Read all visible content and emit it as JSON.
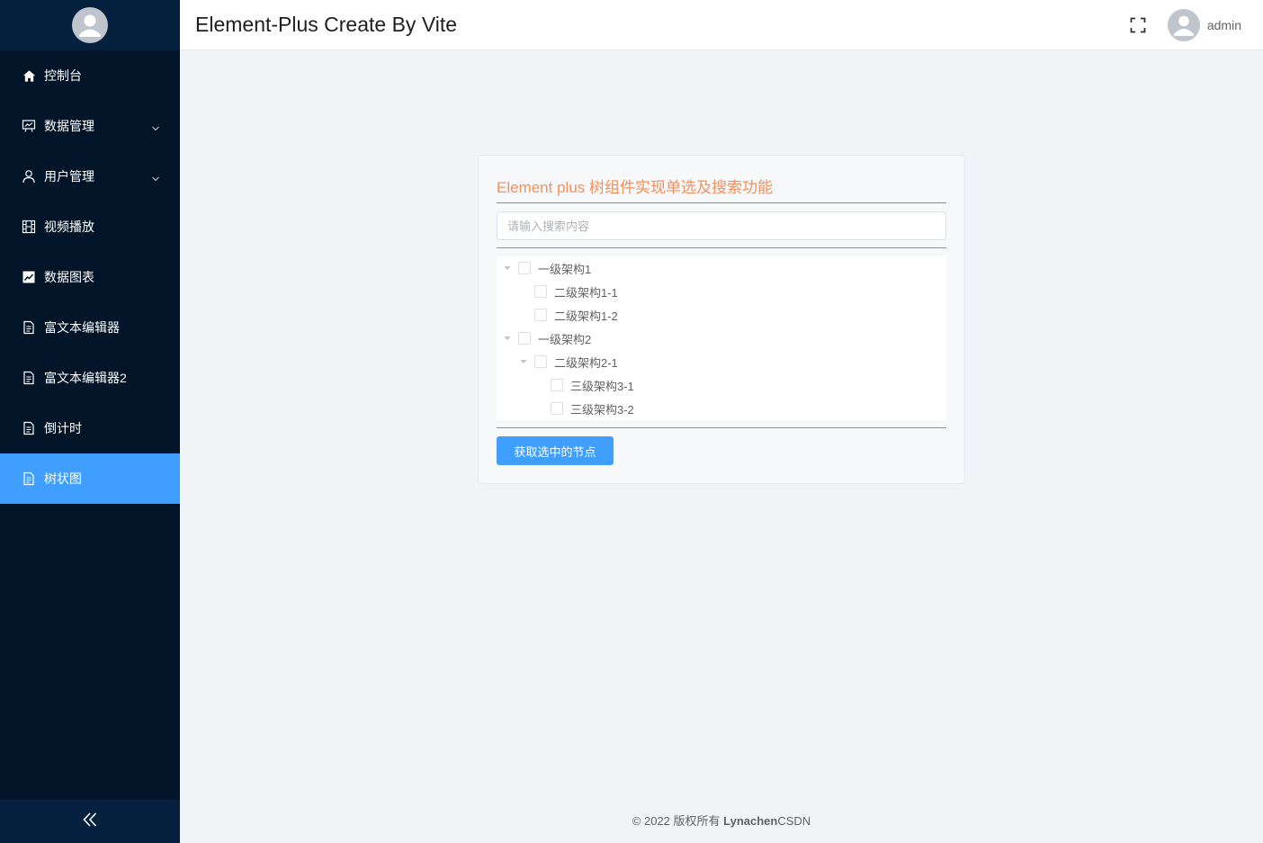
{
  "header": {
    "title": "Element-Plus Create By Vite",
    "username": "admin"
  },
  "sidebar": {
    "items": [
      {
        "label": "控制台",
        "icon": "home-icon"
      },
      {
        "label": "数据管理",
        "icon": "data-board-icon"
      },
      {
        "label": "用户管理",
        "icon": "user-icon"
      },
      {
        "label": "视频播放",
        "icon": "film-icon"
      },
      {
        "label": "数据图表",
        "icon": "chart-icon"
      },
      {
        "label": "富文本编辑器",
        "icon": "document-icon"
      },
      {
        "label": "富文本编辑器2",
        "icon": "document-icon"
      },
      {
        "label": "倒计时",
        "icon": "document-icon"
      },
      {
        "label": "树状图",
        "icon": "document-icon"
      }
    ],
    "active_index": 8
  },
  "card": {
    "title": "Element plus 树组件实现单选及搜索功能",
    "search_placeholder": "请输入搜索内容",
    "tree": [
      {
        "label": "一级架构1",
        "level": 1,
        "expandable": true,
        "checked": false
      },
      {
        "label": "二级架构1-1",
        "level": 2,
        "expandable": false,
        "checked": false
      },
      {
        "label": "二级架构1-2",
        "level": 2,
        "expandable": false,
        "checked": false
      },
      {
        "label": "一级架构2",
        "level": 1,
        "expandable": true,
        "checked": false
      },
      {
        "label": "二级架构2-1",
        "level": 2,
        "expandable": true,
        "checked": false
      },
      {
        "label": "三级架构3-1",
        "level": 3,
        "expandable": false,
        "checked": false
      },
      {
        "label": "三级架构3-2",
        "level": 3,
        "expandable": false,
        "checked": false
      }
    ],
    "button_label": "获取选中的节点"
  },
  "footer": {
    "prefix": "© 2022 版权所有 ",
    "author": "Lynachen",
    "suffix": "CSDN"
  },
  "colors": {
    "sidebar_bg": "#011428",
    "active": "#409eff",
    "card_title": "#f0915e"
  }
}
